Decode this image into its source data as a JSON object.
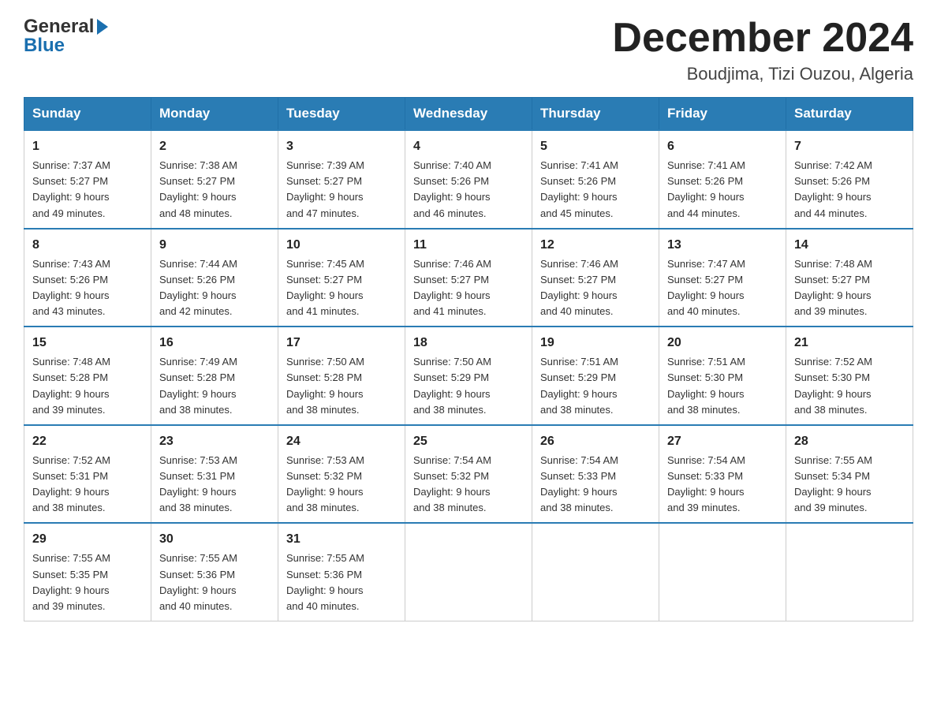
{
  "header": {
    "logo_line1": "General",
    "logo_line2": "Blue",
    "month_title": "December 2024",
    "location": "Boudjima, Tizi Ouzou, Algeria"
  },
  "calendar": {
    "days_of_week": [
      "Sunday",
      "Monday",
      "Tuesday",
      "Wednesday",
      "Thursday",
      "Friday",
      "Saturday"
    ],
    "weeks": [
      [
        {
          "day": "1",
          "sunrise": "7:37 AM",
          "sunset": "5:27 PM",
          "daylight": "9 hours and 49 minutes."
        },
        {
          "day": "2",
          "sunrise": "7:38 AM",
          "sunset": "5:27 PM",
          "daylight": "9 hours and 48 minutes."
        },
        {
          "day": "3",
          "sunrise": "7:39 AM",
          "sunset": "5:27 PM",
          "daylight": "9 hours and 47 minutes."
        },
        {
          "day": "4",
          "sunrise": "7:40 AM",
          "sunset": "5:26 PM",
          "daylight": "9 hours and 46 minutes."
        },
        {
          "day": "5",
          "sunrise": "7:41 AM",
          "sunset": "5:26 PM",
          "daylight": "9 hours and 45 minutes."
        },
        {
          "day": "6",
          "sunrise": "7:41 AM",
          "sunset": "5:26 PM",
          "daylight": "9 hours and 44 minutes."
        },
        {
          "day": "7",
          "sunrise": "7:42 AM",
          "sunset": "5:26 PM",
          "daylight": "9 hours and 44 minutes."
        }
      ],
      [
        {
          "day": "8",
          "sunrise": "7:43 AM",
          "sunset": "5:26 PM",
          "daylight": "9 hours and 43 minutes."
        },
        {
          "day": "9",
          "sunrise": "7:44 AM",
          "sunset": "5:26 PM",
          "daylight": "9 hours and 42 minutes."
        },
        {
          "day": "10",
          "sunrise": "7:45 AM",
          "sunset": "5:27 PM",
          "daylight": "9 hours and 41 minutes."
        },
        {
          "day": "11",
          "sunrise": "7:46 AM",
          "sunset": "5:27 PM",
          "daylight": "9 hours and 41 minutes."
        },
        {
          "day": "12",
          "sunrise": "7:46 AM",
          "sunset": "5:27 PM",
          "daylight": "9 hours and 40 minutes."
        },
        {
          "day": "13",
          "sunrise": "7:47 AM",
          "sunset": "5:27 PM",
          "daylight": "9 hours and 40 minutes."
        },
        {
          "day": "14",
          "sunrise": "7:48 AM",
          "sunset": "5:27 PM",
          "daylight": "9 hours and 39 minutes."
        }
      ],
      [
        {
          "day": "15",
          "sunrise": "7:48 AM",
          "sunset": "5:28 PM",
          "daylight": "9 hours and 39 minutes."
        },
        {
          "day": "16",
          "sunrise": "7:49 AM",
          "sunset": "5:28 PM",
          "daylight": "9 hours and 38 minutes."
        },
        {
          "day": "17",
          "sunrise": "7:50 AM",
          "sunset": "5:28 PM",
          "daylight": "9 hours and 38 minutes."
        },
        {
          "day": "18",
          "sunrise": "7:50 AM",
          "sunset": "5:29 PM",
          "daylight": "9 hours and 38 minutes."
        },
        {
          "day": "19",
          "sunrise": "7:51 AM",
          "sunset": "5:29 PM",
          "daylight": "9 hours and 38 minutes."
        },
        {
          "day": "20",
          "sunrise": "7:51 AM",
          "sunset": "5:30 PM",
          "daylight": "9 hours and 38 minutes."
        },
        {
          "day": "21",
          "sunrise": "7:52 AM",
          "sunset": "5:30 PM",
          "daylight": "9 hours and 38 minutes."
        }
      ],
      [
        {
          "day": "22",
          "sunrise": "7:52 AM",
          "sunset": "5:31 PM",
          "daylight": "9 hours and 38 minutes."
        },
        {
          "day": "23",
          "sunrise": "7:53 AM",
          "sunset": "5:31 PM",
          "daylight": "9 hours and 38 minutes."
        },
        {
          "day": "24",
          "sunrise": "7:53 AM",
          "sunset": "5:32 PM",
          "daylight": "9 hours and 38 minutes."
        },
        {
          "day": "25",
          "sunrise": "7:54 AM",
          "sunset": "5:32 PM",
          "daylight": "9 hours and 38 minutes."
        },
        {
          "day": "26",
          "sunrise": "7:54 AM",
          "sunset": "5:33 PM",
          "daylight": "9 hours and 38 minutes."
        },
        {
          "day": "27",
          "sunrise": "7:54 AM",
          "sunset": "5:33 PM",
          "daylight": "9 hours and 39 minutes."
        },
        {
          "day": "28",
          "sunrise": "7:55 AM",
          "sunset": "5:34 PM",
          "daylight": "9 hours and 39 minutes."
        }
      ],
      [
        {
          "day": "29",
          "sunrise": "7:55 AM",
          "sunset": "5:35 PM",
          "daylight": "9 hours and 39 minutes."
        },
        {
          "day": "30",
          "sunrise": "7:55 AM",
          "sunset": "5:36 PM",
          "daylight": "9 hours and 40 minutes."
        },
        {
          "day": "31",
          "sunrise": "7:55 AM",
          "sunset": "5:36 PM",
          "daylight": "9 hours and 40 minutes."
        },
        null,
        null,
        null,
        null
      ]
    ],
    "labels": {
      "sunrise": "Sunrise:",
      "sunset": "Sunset:",
      "daylight": "Daylight:"
    }
  }
}
